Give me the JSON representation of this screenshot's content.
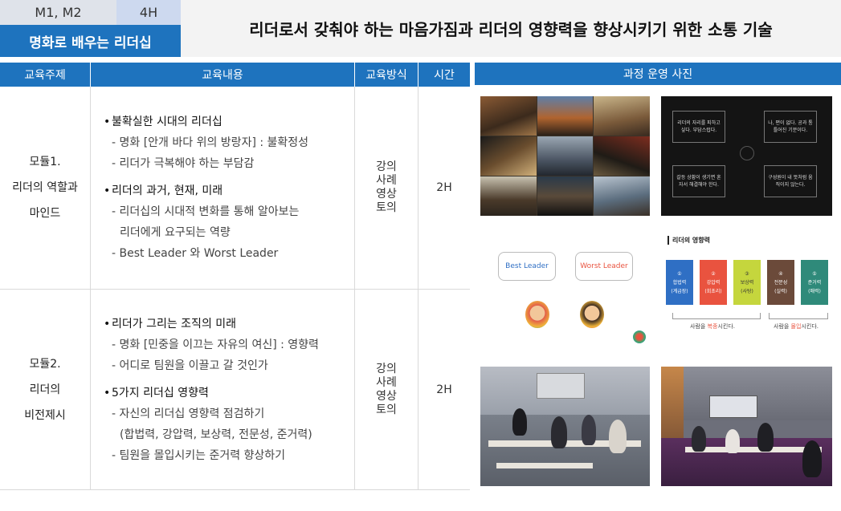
{
  "header": {
    "code": "M1, M2",
    "hours": "4H",
    "tag": "명화로 배우는 리더십",
    "title": "리더로서 갖춰야 하는 마음가짐과 리더의 영향력을 향상시키기 위한 소통 기술"
  },
  "table": {
    "columns": [
      "교육주제",
      "교육내용",
      "교육방식",
      "시간"
    ],
    "rows": [
      {
        "topic_lines": [
          "모듈1.",
          "리더의 역할과",
          "마인드"
        ],
        "sections": [
          {
            "heading": "불확실한 시대의 리더십",
            "items": [
              [
                "- 명화 [안개 바다 위의 방랑자] : 불확정성"
              ],
              [
                "- 리더가 극복해야 하는 부담감"
              ]
            ]
          },
          {
            "heading": "리더의 과거, 현재, 미래",
            "items": [
              [
                "- 리더십의 시대적 변화를 통해 알아보는",
                "리더에게 요구되는 역량"
              ],
              [
                "- Best Leader 와 Worst Leader"
              ]
            ]
          }
        ],
        "method_lines": [
          "강의",
          "사례",
          "영상",
          "토의"
        ],
        "time": "2H"
      },
      {
        "topic_lines": [
          "모듈2.",
          "리더의",
          "비전제시"
        ],
        "sections": [
          {
            "heading": "리더가 그리는 조직의 미래",
            "items": [
              [
                "- 명화 [민중을 이끄는 자유의 여신] : 영향력"
              ],
              [
                "- 어디로 팀원을 이끌고 갈 것인가"
              ]
            ]
          },
          {
            "heading": "5가지 리더십 영향력",
            "items": [
              [
                "- 자신의 리더십 영향력 점검하기",
                "(합법력, 강압력, 보상력, 전문성, 준거력)"
              ],
              [
                "- 팀원을 몰입시키는 준거력 향상하기"
              ]
            ]
          }
        ],
        "method_lines": [
          "강의",
          "사례",
          "영상",
          "토의"
        ],
        "time": "2H"
      }
    ]
  },
  "photos": {
    "header": "과정 운영 사진",
    "slide_questions": [
      "리더의 자리를 피하고 싶다. 부담스럽다.",
      "나, 편이 없다. 공과 통틀어진 기분이다.",
      "갈등 상황이 생기면 혼자서 해결해야 한다.",
      "구성원이 내 뜻처럼 움직이지 않는다."
    ],
    "leader_graphic": {
      "best": "Best Leader",
      "worst": "Worst Leader"
    },
    "influence_chart": {
      "title": "리더의 영향력",
      "powers": [
        {
          "num": "①",
          "name": "합법력",
          "sub": "(계급장)",
          "color": "#2f6fc4"
        },
        {
          "num": "②",
          "name": "강압력",
          "sub": "(회초리)",
          "color": "#e9533f"
        },
        {
          "num": "③",
          "name": "보상력",
          "sub": "(사탕)",
          "color": "#c5d63d"
        },
        {
          "num": "④",
          "name": "전문성",
          "sub": "(실력)",
          "color": "#6b4a3a"
        },
        {
          "num": "⑤",
          "name": "준거력",
          "sub": "(매력)",
          "color": "#2f8a7a"
        }
      ],
      "caption_left_pre": "사람을 ",
      "caption_left_mark": "복종",
      "caption_left_post": "시킨다.",
      "caption_right_pre": "사람을 ",
      "caption_right_mark": "몰입",
      "caption_right_post": "시킨다.",
      "mark_color": "#e9533f"
    }
  }
}
